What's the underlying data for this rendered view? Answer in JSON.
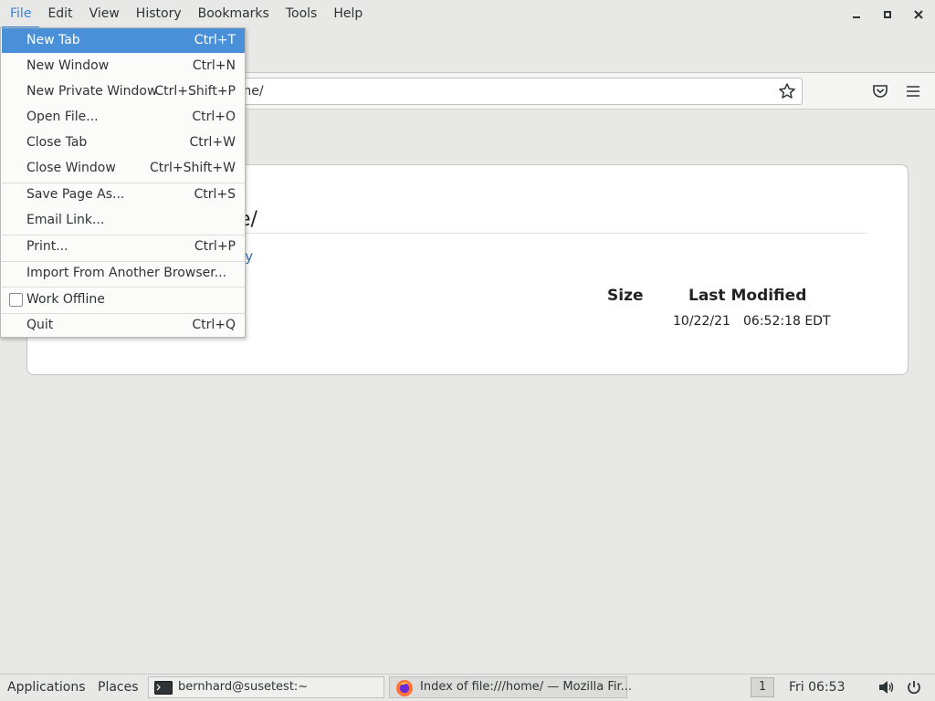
{
  "menubar": {
    "items": [
      "File",
      "Edit",
      "View",
      "History",
      "Bookmarks",
      "Tools",
      "Help"
    ]
  },
  "urlbar": {
    "value": "ome/"
  },
  "page": {
    "title_fragment": "ne/",
    "parent_link_fragment": "tory",
    "columns": {
      "size": "Size",
      "modified": "Last Modified"
    },
    "row": {
      "date": "10/22/21",
      "time": "06:52:18 EDT"
    }
  },
  "file_menu": {
    "items": [
      {
        "label": "New Tab",
        "shortcut": "Ctrl+T"
      },
      {
        "label": "New Window",
        "shortcut": "Ctrl+N"
      },
      {
        "label": "New Private Window",
        "shortcut": "Ctrl+Shift+P"
      },
      {
        "label": "Open File...",
        "shortcut": "Ctrl+O"
      },
      {
        "label": "Close Tab",
        "shortcut": "Ctrl+W"
      },
      {
        "label": "Close Window",
        "shortcut": "Ctrl+Shift+W"
      },
      {
        "label": "Save Page As...",
        "shortcut": "Ctrl+S"
      },
      {
        "label": "Email Link...",
        "shortcut": ""
      },
      {
        "label": "Print...",
        "shortcut": "Ctrl+P"
      },
      {
        "label": "Import From Another Browser...",
        "shortcut": ""
      },
      {
        "label": "Work Offline",
        "shortcut": ""
      },
      {
        "label": "Quit",
        "shortcut": "Ctrl+Q"
      }
    ]
  },
  "taskbar": {
    "applications": "Applications",
    "places": "Places",
    "terminal_window": "bernhard@susetest:~",
    "firefox_window": "Index of file:///home/ — Mozilla Fir...",
    "workspace": "1",
    "clock": "Fri 06:53"
  },
  "colors": {
    "accent": "#3584e4",
    "highlight": "#4a90d9",
    "link": "#2a6fb5"
  }
}
